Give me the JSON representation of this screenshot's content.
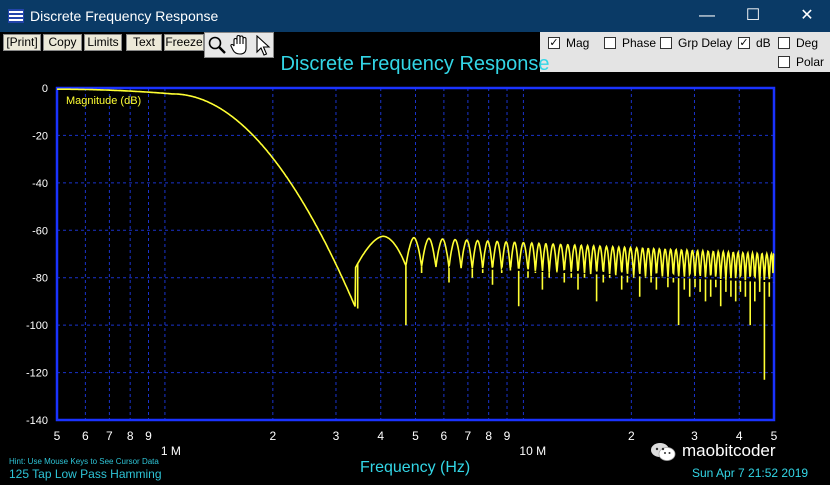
{
  "window": {
    "title": "Discrete Frequency Response",
    "controls": [
      "—",
      "☐",
      "✕"
    ]
  },
  "toolbar": {
    "buttons": [
      "[Print]",
      "Copy",
      "Limits",
      "Text",
      "Freeze"
    ],
    "tool_icons": [
      "zoom-icon",
      "hand-pan-icon",
      "pointer-icon"
    ]
  },
  "options": [
    {
      "label": "Mag",
      "checked": true
    },
    {
      "label": "Phase",
      "checked": false
    },
    {
      "label": "Grp Delay",
      "checked": false
    },
    {
      "label": "dB",
      "checked": true
    },
    {
      "label": "Deg",
      "checked": false
    },
    {
      "label": "Polar",
      "checked": false
    }
  ],
  "footer": {
    "hint": "Hint: Use Mouse Keys to See Cursor Data",
    "filter": "125 Tap Low Pass Hamming",
    "datetime": "Sun Apr  7 21:52 2019"
  },
  "watermark": "maobitcoder",
  "colors": {
    "titlebar": "#0a3a66",
    "trace": "#ffff33",
    "frame": "#1a33ff",
    "grid": "#1a33cc",
    "text": "#33d6e6",
    "axis_text": "#ffffff"
  },
  "chart_data": {
    "type": "line",
    "title": "Discrete Frequency Response",
    "xlabel": "Frequency (Hz)",
    "ylabel": "",
    "series": [
      {
        "name": "Magnitude (dB)"
      }
    ],
    "x_scale": "log",
    "xlim": [
      500000,
      50000000
    ],
    "ylim": [
      -140,
      0
    ],
    "y_ticks": [
      0,
      -20,
      -40,
      -60,
      -80,
      -100,
      -120,
      -140
    ],
    "x_ticks": [
      {
        "value": 500000,
        "label": "5"
      },
      {
        "value": 600000,
        "label": "6"
      },
      {
        "value": 700000,
        "label": "7"
      },
      {
        "value": 800000,
        "label": "8"
      },
      {
        "value": 900000,
        "label": "9"
      },
      {
        "value": 1000000,
        "label": "1 M"
      },
      {
        "value": 2000000,
        "label": "2"
      },
      {
        "value": 3000000,
        "label": "3"
      },
      {
        "value": 4000000,
        "label": "4"
      },
      {
        "value": 5000000,
        "label": "5"
      },
      {
        "value": 6000000,
        "label": "6"
      },
      {
        "value": 7000000,
        "label": "7"
      },
      {
        "value": 8000000,
        "label": "8"
      },
      {
        "value": 9000000,
        "label": "9"
      },
      {
        "value": 10000000,
        "label": "10 M"
      },
      {
        "value": 20000000,
        "label": "2"
      },
      {
        "value": 30000000,
        "label": "3"
      },
      {
        "value": 40000000,
        "label": "4"
      },
      {
        "value": 50000000,
        "label": "5"
      }
    ],
    "grid": true,
    "passband_edge_hz": 1400000,
    "stopband_start_hz": 3400000,
    "stopband_level_db": -62,
    "stopband_level_end_db": -70,
    "notch_frequencies_hz": [
      3450000,
      4700000,
      5200000,
      5700000,
      6200000,
      6700000,
      7200000,
      7700000,
      8200000,
      8700000,
      9200000,
      9700000,
      10300000,
      10800000,
      11300000,
      11800000,
      12400000,
      13000000,
      13600000,
      14200000,
      14800000,
      15400000,
      16000000,
      16700000,
      17400000,
      18100000,
      18800000,
      19500000,
      20300000,
      21100000,
      21900000,
      22700000,
      23500000,
      24400000,
      25300000,
      26200000,
      27100000,
      28100000,
      29100000,
      30100000,
      31100000,
      32200000,
      33300000,
      34400000,
      35500000,
      36700000,
      37900000,
      39100000,
      40300000,
      41600000,
      42900000,
      44200000,
      45600000,
      47000000,
      48500000,
      49800000
    ],
    "notch_depths_db": [
      -93,
      -100,
      -78,
      -75,
      -82,
      -75,
      -80,
      -78,
      -83,
      -78,
      -75,
      -92,
      -80,
      -78,
      -85,
      -80,
      -78,
      -82,
      -80,
      -85,
      -80,
      -78,
      -90,
      -82,
      -80,
      -78,
      -85,
      -82,
      -80,
      -88,
      -80,
      -82,
      -85,
      -80,
      -84,
      -82,
      -100,
      -85,
      -88,
      -84,
      -86,
      -90,
      -88,
      -84,
      -92,
      -86,
      -88,
      -90,
      -86,
      -88,
      -100,
      -90,
      -86,
      -123,
      -88,
      -82
    ]
  }
}
